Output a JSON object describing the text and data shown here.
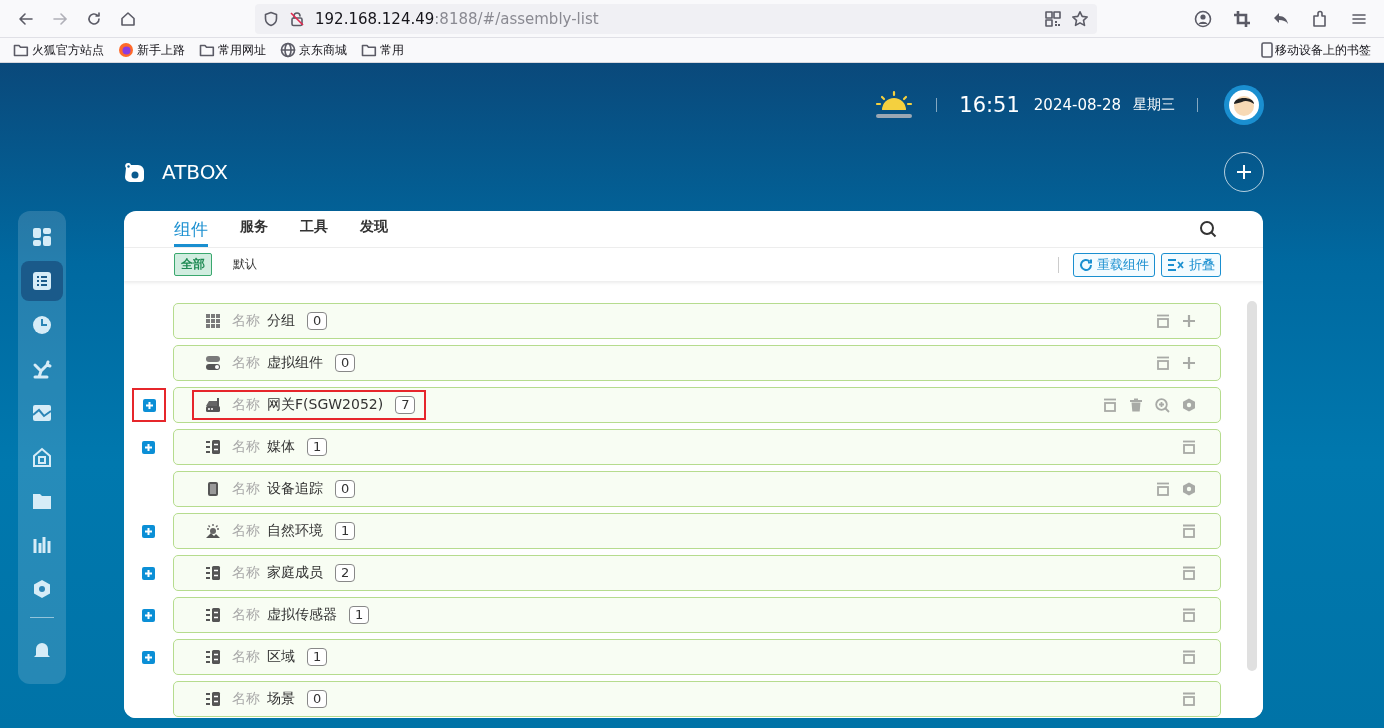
{
  "browser": {
    "url_host": "192.168.124.49",
    "url_rest": ":8188/#/assembly-list",
    "bookmarks": [
      {
        "kind": "folder",
        "label": "火狐官方站点"
      },
      {
        "kind": "firefox",
        "label": "新手上路"
      },
      {
        "kind": "folder",
        "label": "常用网址"
      },
      {
        "kind": "globe",
        "label": "京东商城"
      },
      {
        "kind": "folder",
        "label": "常用"
      }
    ],
    "mobile_bookmarks": "移动设备上的书签"
  },
  "header": {
    "time": "16:51",
    "date": "2024-08-28",
    "weekday": "星期三"
  },
  "app": {
    "title": "ATBOX"
  },
  "sidebar": {
    "items": [
      {
        "kind": "dashboard",
        "selected": false
      },
      {
        "kind": "list",
        "selected": true
      },
      {
        "kind": "clock",
        "selected": false
      },
      {
        "kind": "robot",
        "selected": false
      },
      {
        "kind": "map",
        "selected": false
      },
      {
        "kind": "home",
        "selected": false
      },
      {
        "kind": "folder",
        "selected": false
      },
      {
        "kind": "bars",
        "selected": false
      },
      {
        "kind": "hexagon",
        "selected": false
      },
      {
        "kind": "bell",
        "selected": false
      }
    ]
  },
  "tabs": [
    {
      "label": "组件",
      "selected": true
    },
    {
      "label": "服务",
      "selected": false
    },
    {
      "label": "工具",
      "selected": false
    },
    {
      "label": "发现",
      "selected": false
    }
  ],
  "filters": [
    {
      "label": "全部",
      "selected": true
    },
    {
      "label": "默认",
      "selected": false
    }
  ],
  "toolbar": [
    {
      "kind": "reload",
      "label": "重载组件"
    },
    {
      "kind": "collapse",
      "label": "折叠"
    }
  ],
  "rows": [
    {
      "expandable": false,
      "highlighted": false,
      "kind": "grid",
      "label": "名称",
      "name": "分组",
      "count": "0",
      "actions": [
        {
          "kind": "archive"
        },
        {
          "kind": "add"
        }
      ]
    },
    {
      "expandable": false,
      "highlighted": false,
      "kind": "toggle",
      "label": "名称",
      "name": "虚拟组件",
      "count": "0",
      "actions": [
        {
          "kind": "archive"
        },
        {
          "kind": "add"
        }
      ]
    },
    {
      "expandable": true,
      "highlighted": true,
      "kind": "gateway",
      "label": "名称",
      "name": "网关F(SGW2052)",
      "count": "7",
      "actions": [
        {
          "kind": "archive"
        },
        {
          "kind": "delete"
        },
        {
          "kind": "zoom"
        },
        {
          "kind": "hexagon"
        }
      ]
    },
    {
      "expandable": true,
      "highlighted": false,
      "kind": "list",
      "label": "名称",
      "name": "媒体",
      "count": "1",
      "actions": [
        {
          "kind": "archive"
        }
      ]
    },
    {
      "expandable": false,
      "highlighted": false,
      "kind": "phone",
      "label": "名称",
      "name": "设备追踪",
      "count": "0",
      "actions": [
        {
          "kind": "archive"
        },
        {
          "kind": "hexagon"
        }
      ]
    },
    {
      "expandable": true,
      "highlighted": false,
      "kind": "weather",
      "label": "名称",
      "name": "自然环境",
      "count": "1",
      "actions": [
        {
          "kind": "archive"
        }
      ]
    },
    {
      "expandable": true,
      "highlighted": false,
      "kind": "list",
      "label": "名称",
      "name": "家庭成员",
      "count": "2",
      "actions": [
        {
          "kind": "archive"
        }
      ]
    },
    {
      "expandable": true,
      "highlighted": false,
      "kind": "list",
      "label": "名称",
      "name": "虚拟传感器",
      "count": "1",
      "actions": [
        {
          "kind": "archive"
        }
      ]
    },
    {
      "expandable": true,
      "highlighted": false,
      "kind": "list",
      "label": "名称",
      "name": "区域",
      "count": "1",
      "actions": [
        {
          "kind": "archive"
        }
      ]
    },
    {
      "expandable": false,
      "highlighted": false,
      "kind": "list",
      "label": "名称",
      "name": "场景",
      "count": "0",
      "actions": [
        {
          "kind": "archive"
        }
      ]
    }
  ]
}
